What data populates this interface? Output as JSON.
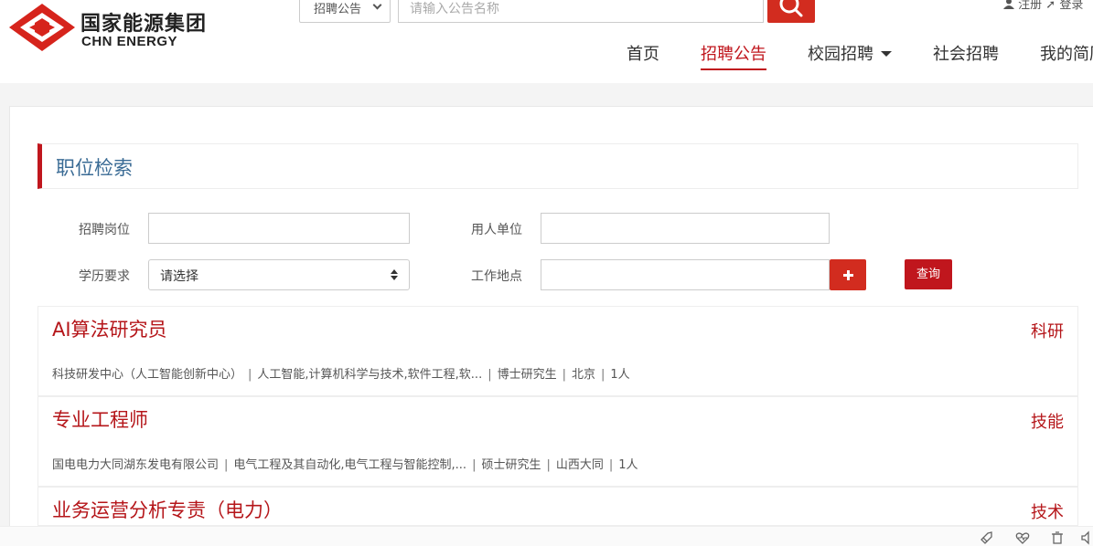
{
  "header": {
    "logo": {
      "cn": "国家能源集团",
      "en": "CHN ENERGY"
    },
    "search": {
      "type_selected": "招聘公告",
      "placeholder": "请输入公告名称"
    },
    "top_links": {
      "register": "注册",
      "login": "登录"
    },
    "nav": [
      {
        "label": "首页",
        "active": false
      },
      {
        "label": "招聘公告",
        "active": true
      },
      {
        "label": "校园招聘",
        "active": false,
        "has_dropdown": true
      },
      {
        "label": "社会招聘",
        "active": false
      },
      {
        "label": "我的简历",
        "active": false
      }
    ]
  },
  "filters": {
    "section_title": "职位检索",
    "position_label": "招聘岗位",
    "position_value": "",
    "employer_label": "用人单位",
    "employer_value": "",
    "education_label": "学历要求",
    "education_selected": "请选择",
    "location_label": "工作地点",
    "location_value": "",
    "query_button": "查询"
  },
  "jobs": [
    {
      "title": "AI算法研究员",
      "category": "科研",
      "org": "科技研发中心（人工智能创新中心）",
      "major": "人工智能,计算机科学与技术,软件工程,软...",
      "degree": "博士研究生",
      "location": "北京",
      "count": "1人"
    },
    {
      "title": "专业工程师",
      "category": "技能",
      "org": "国电电力大同湖东发电有限公司",
      "major": "电气工程及其自动化,电气工程与智能控制,...",
      "degree": "硕士研究生",
      "location": "山西大同",
      "count": "1人"
    },
    {
      "title": "业务运营分析专责（电力）",
      "category": "技术"
    }
  ],
  "colors": {
    "brand_red": "#c0161d",
    "button_red": "#d22c1f",
    "title_blue": "#3a6b95"
  }
}
